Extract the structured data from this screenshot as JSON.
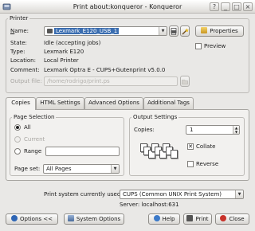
{
  "window": {
    "title": "Print about:konqueror - Konqueror",
    "controls": [
      "?",
      "_",
      "□",
      "×"
    ]
  },
  "printer": {
    "group_label": "Printer",
    "name_label": "Name:",
    "name_value": "Lexmark_E120_USB_1",
    "properties_label": "Properties",
    "preview_label": "Preview",
    "state_label": "State:",
    "state_value": "Idle (accepting jobs)",
    "type_label": "Type:",
    "type_value": "Lexmark E120",
    "location_label": "Location:",
    "location_value": "Local Printer",
    "comment_label": "Comment:",
    "comment_value": "Lexmark Optra E - CUPS+Gutenprint v5.0.0",
    "output_label": "Output file:",
    "output_value": "/home/rodrigo/print.ps"
  },
  "tabs": [
    {
      "label": "Copies"
    },
    {
      "label": "HTML Settings"
    },
    {
      "label": "Advanced Options"
    },
    {
      "label": "Additional Tags"
    }
  ],
  "page_selection": {
    "group_label": "Page Selection",
    "all_label": "All",
    "current_label": "Current",
    "range_label": "Range",
    "range_value": "",
    "page_set_label": "Page set:",
    "page_set_value": "All Pages"
  },
  "output_settings": {
    "group_label": "Output Settings",
    "copies_label": "Copies:",
    "copies_value": "1",
    "collate_label": "Collate",
    "collate_checked": true,
    "reverse_label": "Reverse",
    "reverse_checked": false
  },
  "system": {
    "print_system_label": "Print system currently used:",
    "print_system_value": "CUPS (Common UNIX Print System)",
    "server_text": "Server: localhost:631"
  },
  "buttons": {
    "options": "Options <<",
    "system_options": "System Options",
    "help": "Help",
    "print": "Print",
    "close": "Close"
  },
  "colors": {
    "accent": "#3a6db0",
    "background": "#e9e8e6"
  }
}
